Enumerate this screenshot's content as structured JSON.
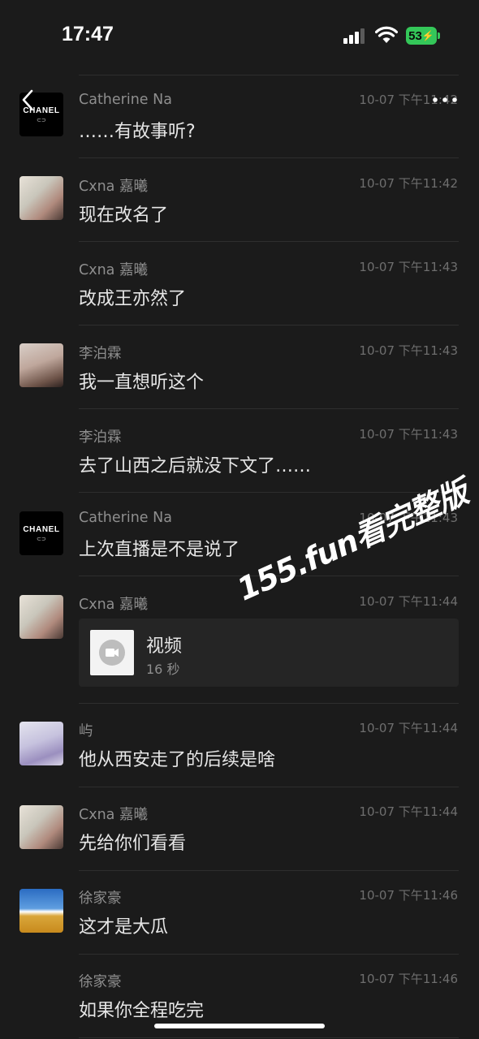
{
  "status": {
    "time": "17:47",
    "battery": "53"
  },
  "messages": [
    {
      "sender": "Catherine Na",
      "time": "10-07 下午11:42",
      "text": "……有故事听?"
    },
    {
      "sender": "Cxna 嘉曦",
      "time": "10-07 下午11:42",
      "text": "现在改名了"
    },
    {
      "sender": "Cxna 嘉曦",
      "time": "10-07 下午11:43",
      "text": "改成王亦然了"
    },
    {
      "sender": "李泊霖",
      "time": "10-07 下午11:43",
      "text": "我一直想听这个"
    },
    {
      "sender": "李泊霖",
      "time": "10-07 下午11:43",
      "text": "去了山西之后就没下文了……"
    },
    {
      "sender": "Catherine Na",
      "time": "10-07 下午11:43",
      "text": "上次直播是不是说了"
    },
    {
      "sender": "Cxna 嘉曦",
      "time": "10-07 下午11:44",
      "video_title": "视频",
      "video_duration": "16 秒"
    },
    {
      "sender": "屿",
      "time": "10-07 下午11:44",
      "text": "他从西安走了的后续是啥"
    },
    {
      "sender": "Cxna 嘉曦",
      "time": "10-07 下午11:44",
      "text": "先给你们看看"
    },
    {
      "sender": "徐家豪",
      "time": "10-07 下午11:46",
      "text": "这才是大瓜"
    },
    {
      "sender": "徐家豪",
      "time": "10-07 下午11:46",
      "text": "如果你全程吃完"
    }
  ],
  "avatar_logo_text": "CHANEL",
  "watermark": "155.fun看完整版",
  "icons": [
    "back-chevron-icon",
    "more-icon",
    "signal-icon",
    "wifi-icon",
    "battery-icon",
    "video-camera-icon"
  ],
  "colors": {
    "background": "#1b1b1b",
    "battery": "#34c759",
    "card": "#252525"
  }
}
